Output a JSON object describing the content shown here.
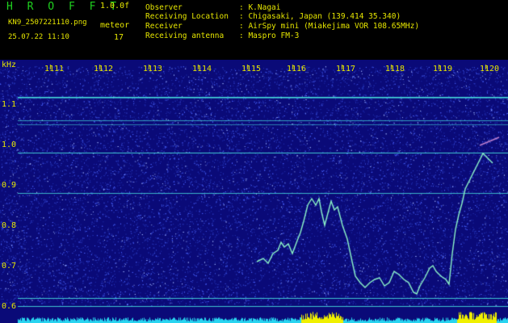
{
  "header": {
    "app_title": "H R O F F T",
    "version": "1.0.0f",
    "file_name": "KN9_2507221110.png",
    "meteor_label": "meteor",
    "timestamp": "25.07.22 11:10",
    "meteor_count": "17",
    "info": [
      {
        "label": "Observer",
        "value": ": K.Nagai"
      },
      {
        "label": "Receiving Location",
        "value": ": Chigasaki, Japan (139.414 35.340)"
      },
      {
        "label": "Receiver",
        "value": ": AirSpy mini (Miakejima VOR 108.65MHz)"
      },
      {
        "label": "Receiving antenna",
        "value": ": Maspro FM-3"
      }
    ]
  },
  "plot": {
    "y_unit": "kHz",
    "y_ticks": [
      "1.1",
      "1.0",
      "0.9",
      "0.8",
      "0.7",
      "0.6"
    ],
    "x_ticks": [
      "1111",
      "1112",
      "1113",
      "1114",
      "1115",
      "1116",
      "1117",
      "1118",
      "1119",
      "1120"
    ],
    "colors": {
      "background": "#0a0a78",
      "noise": "#4a64ff",
      "carrier": "#46dcdc",
      "trace": "#8cf5c8",
      "label": "#e6e600",
      "level": "#29d4f0",
      "peak": "#f0f000"
    }
  }
}
